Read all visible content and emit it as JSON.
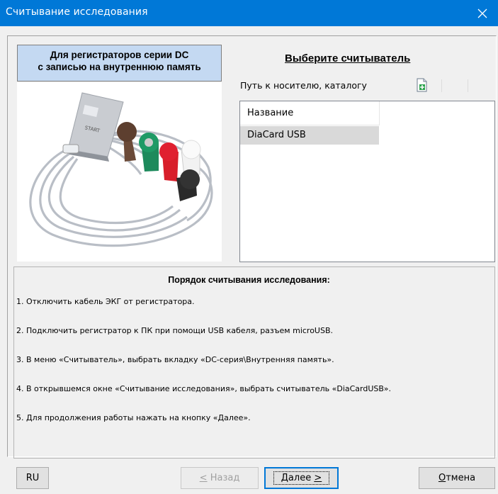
{
  "window": {
    "title": "Считывание исследования"
  },
  "series_box": {
    "line1": "Для регистраторов серии DC",
    "line2": "с записью на внутреннюю память"
  },
  "device_photo": {
    "device_text": "START"
  },
  "reader": {
    "heading": "Выберите считыватель",
    "path_label": "Путь к носителю, каталогу",
    "column_header": "Название",
    "items": [
      "DiaCard USB"
    ]
  },
  "instructions": {
    "title": "Порядок считывания исследования:",
    "steps": [
      "1. Отключить кабель ЭКГ от регистратора.",
      "2. Подключить регистратор к ПК при помощи USB кабеля, разъем microUSB.",
      "3. В меню «Считыватель», выбрать вкладку «DC-серия\\Внутренняя память».",
      "4. В открывшемся окне «Считывание исследования», выбрать считыватель «DiaCardUSB».",
      "5. Для продолжения работы нажать на кнопку «Далее»."
    ]
  },
  "buttons": {
    "lang": "RU",
    "back": {
      "mnemonic": "<",
      "text": " Назад"
    },
    "next": {
      "text": "Далее ",
      "mnemonic": ">"
    },
    "cancel": {
      "mnemonic": "О",
      "text": "тмена"
    }
  },
  "colors": {
    "titlebar": "#0078d7",
    "accent_box": "#c4d9f2",
    "selected_row": "#d9d9d9"
  },
  "icons": {
    "close": "close-icon",
    "add": "add-document-icon"
  }
}
